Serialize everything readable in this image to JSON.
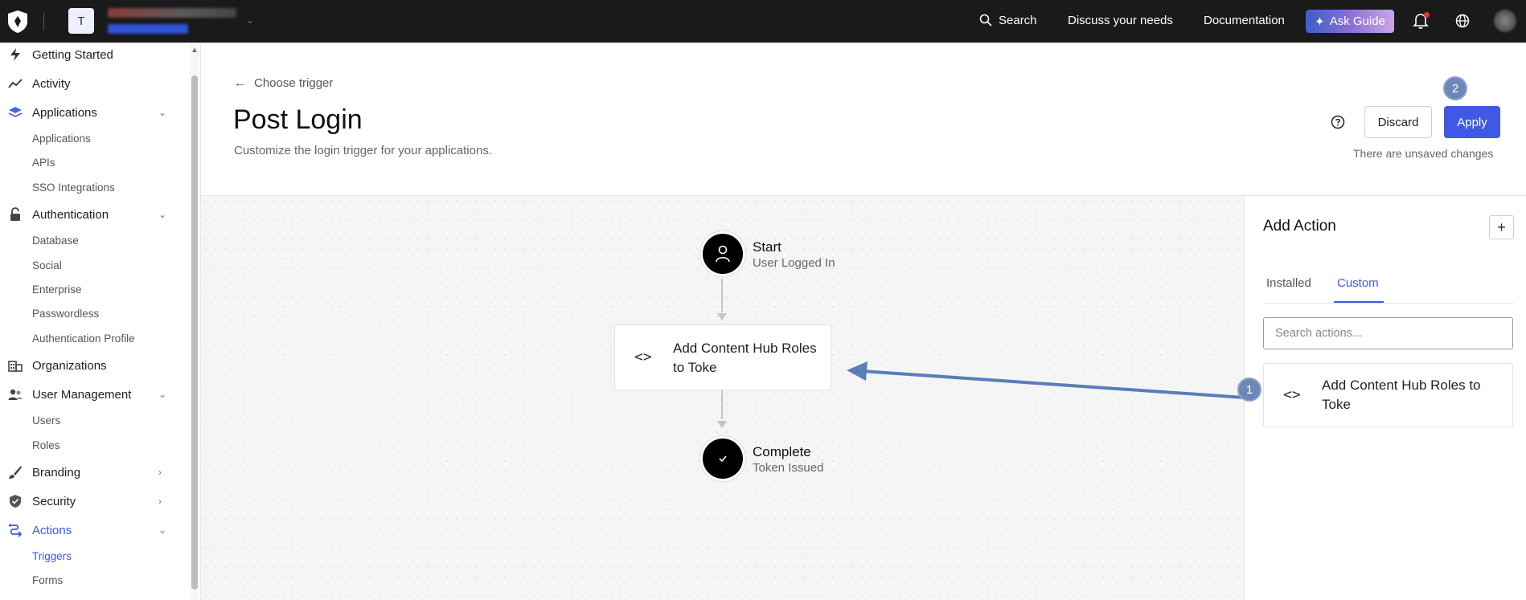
{
  "topbar": {
    "tenant_initial": "T",
    "search_label": "Search",
    "discuss_label": "Discuss your needs",
    "docs_label": "Documentation",
    "ask_guide_label": "Ask Guide"
  },
  "sidebar": {
    "items": [
      {
        "label": "Getting Started",
        "icon": "lightning-icon"
      },
      {
        "label": "Activity",
        "icon": "activity-chart-icon"
      },
      {
        "label": "Applications",
        "icon": "layers-icon",
        "expanded": true,
        "children": [
          "Applications",
          "APIs",
          "SSO Integrations"
        ]
      },
      {
        "label": "Authentication",
        "icon": "lock-icon",
        "expanded": true,
        "children": [
          "Database",
          "Social",
          "Enterprise",
          "Passwordless",
          "Authentication Profile"
        ]
      },
      {
        "label": "Organizations",
        "icon": "building-icon"
      },
      {
        "label": "User Management",
        "icon": "users-icon",
        "expanded": true,
        "children": [
          "Users",
          "Roles"
        ]
      },
      {
        "label": "Branding",
        "icon": "brush-icon",
        "expanded": false
      },
      {
        "label": "Security",
        "icon": "shield-check-icon",
        "expanded": false
      },
      {
        "label": "Actions",
        "icon": "flow-icon",
        "expanded": true,
        "active": true,
        "children": [
          "Triggers",
          "Forms"
        ],
        "active_child": "Triggers"
      }
    ]
  },
  "header": {
    "back_label": "Choose trigger",
    "title": "Post Login",
    "subtitle": "Customize the login trigger for your applications.",
    "discard_label": "Discard",
    "apply_label": "Apply",
    "unsaved_text": "There are unsaved changes"
  },
  "flow": {
    "start": {
      "title": "Start",
      "subtitle": "User Logged In"
    },
    "action": {
      "label": "Add Content Hub Roles to Toke"
    },
    "complete": {
      "title": "Complete",
      "subtitle": "Token Issued"
    }
  },
  "panel": {
    "title": "Add Action",
    "add_symbol": "+",
    "tabs": [
      "Installed",
      "Custom"
    ],
    "active_tab": "Custom",
    "search_placeholder": "Search actions...",
    "cards": [
      {
        "label": "Add Content Hub Roles to Toke"
      }
    ]
  },
  "annotations": {
    "step1": "1",
    "step2": "2"
  },
  "colors": {
    "accent": "#3f59e4",
    "topbar": "#1a1a1a",
    "annotation": "#5b7db8"
  }
}
